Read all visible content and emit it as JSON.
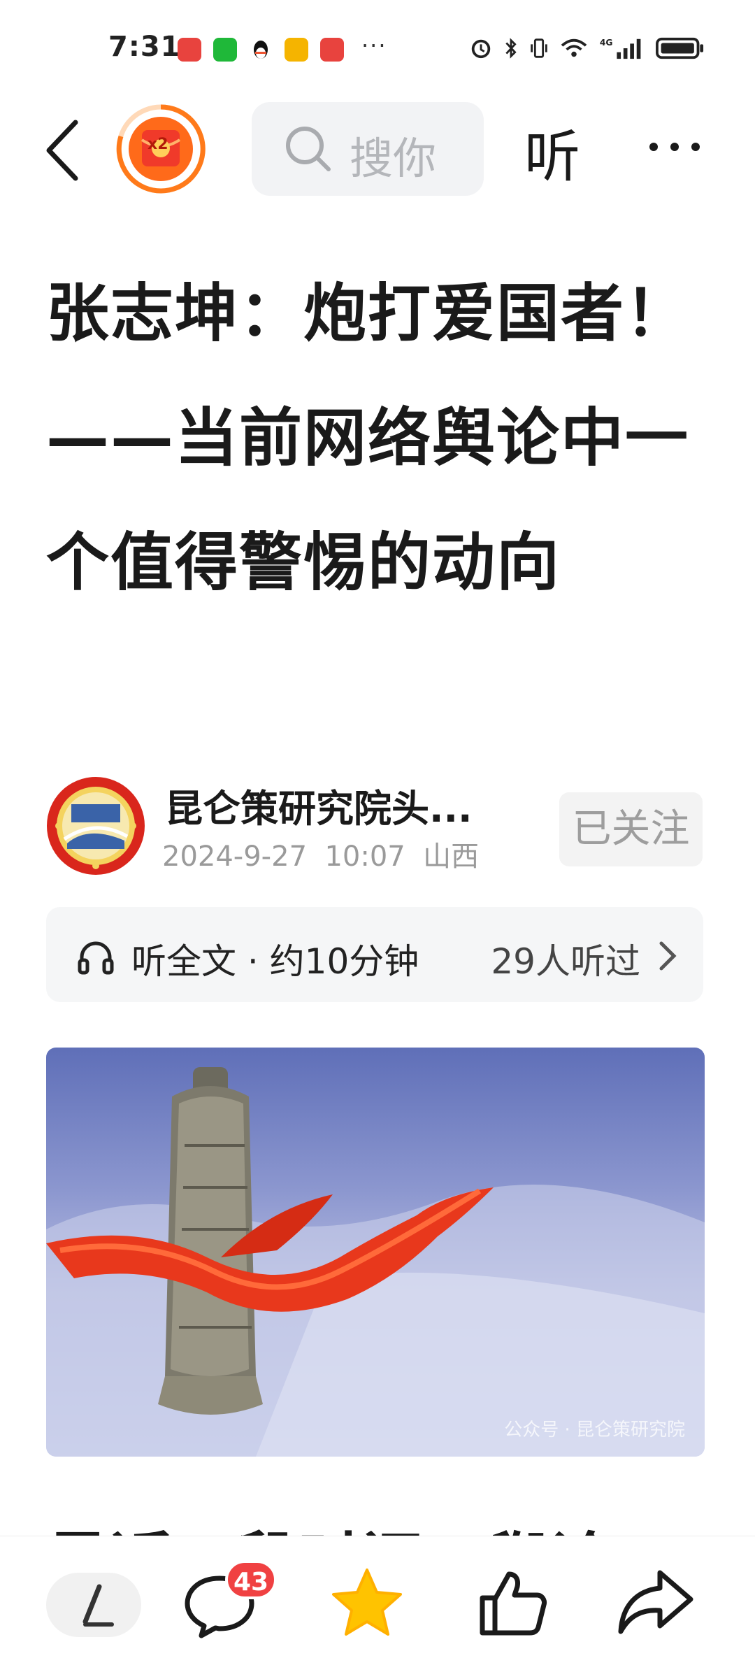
{
  "status_bar": {
    "time": "7:31",
    "more_indicator": "···"
  },
  "nav": {
    "reward_badge": "x2",
    "search_placeholder": "搜你",
    "listen_label": "听"
  },
  "article": {
    "title": "张志坤：炮打爱国者！——当前网络舆论中一个值得警惕的动向",
    "author_name": "昆仑策研究院头...",
    "publish_date": "2024-9-27",
    "publish_time": "10:07",
    "location": "山西",
    "follow_label": "已关注",
    "listen_full_text": "听全文 · 约10分钟",
    "listeners": "29人听过",
    "image_watermark": "公众号 · 昆仑策研究院",
    "next_paragraph_start": "最近一段时间，舆论"
  },
  "bottom_bar": {
    "comment_count": "43"
  },
  "colors": {
    "accent_red": "#f04142",
    "star_yellow": "#ffc300",
    "reward_orange": "#ff7a1a"
  }
}
